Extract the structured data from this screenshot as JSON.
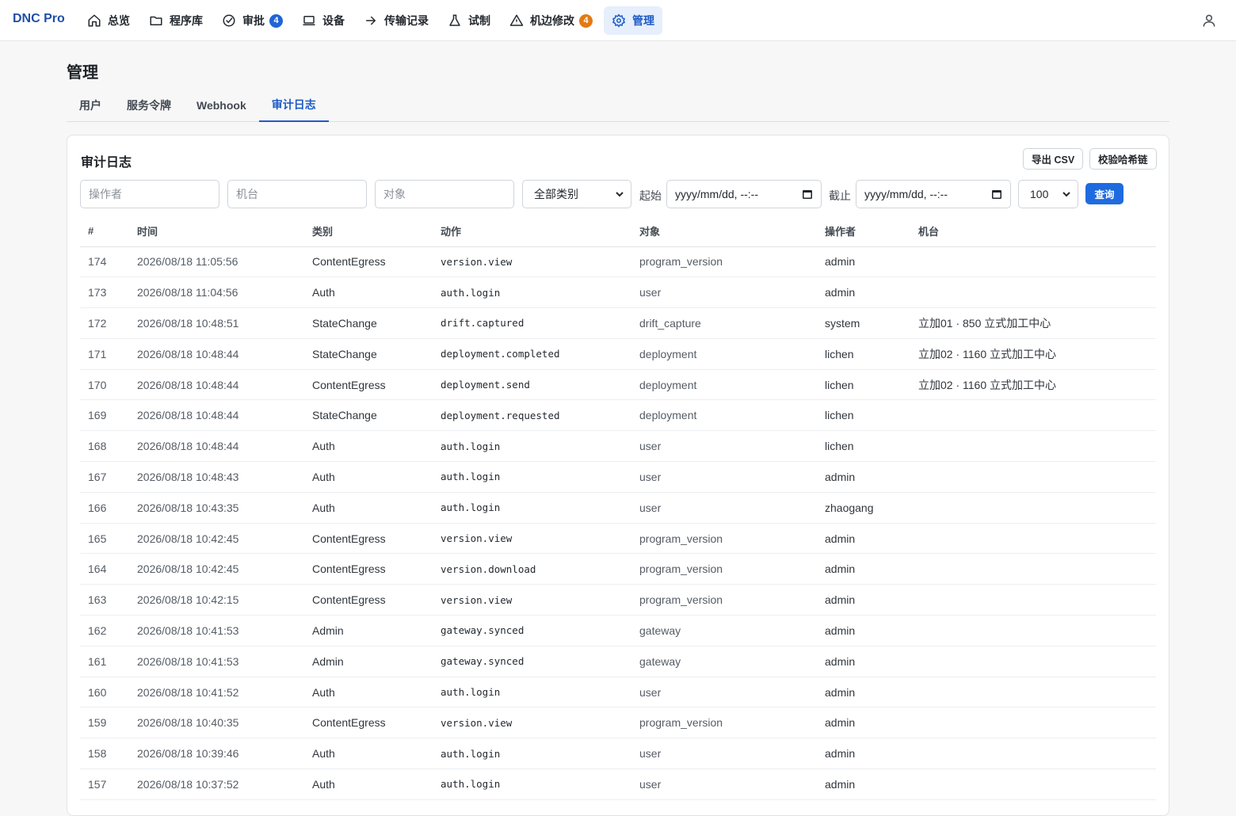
{
  "nav": {
    "brand": "DNC Pro",
    "items": [
      {
        "label": "总览",
        "icon": "home-icon",
        "badge": null
      },
      {
        "label": "程序库",
        "icon": "folder-icon",
        "badge": null
      },
      {
        "label": "审批",
        "icon": "check-circle-icon",
        "badge": "4"
      },
      {
        "label": "设备",
        "icon": "monitor-icon",
        "badge": null
      },
      {
        "label": "传输记录",
        "icon": "arrow-right-icon",
        "badge": null
      },
      {
        "label": "试制",
        "icon": "flask-icon",
        "badge": null
      },
      {
        "label": "机边修改",
        "icon": "warning-icon",
        "badge": "4"
      },
      {
        "label": "管理",
        "icon": "gear-icon",
        "badge": null
      }
    ]
  },
  "page": {
    "title": "管理",
    "tabs": [
      "用户",
      "服务令牌",
      "Webhook",
      "审计日志"
    ],
    "active_tab": "审计日志"
  },
  "card": {
    "title": "审计日志",
    "export_label": "导出 CSV",
    "verify_label": "校验哈希链"
  },
  "filters": {
    "operator_placeholder": "操作者",
    "machine_placeholder": "机台",
    "object_placeholder": "对象",
    "category_value": "全部类别",
    "start_label": "起始",
    "start_value": "yyyy/mm/dd, --:--",
    "end_label": "截止",
    "end_value": "yyyy/mm/dd, --:--",
    "limit_value": "100",
    "query_label": "查询"
  },
  "table": {
    "headers": [
      "#",
      "时间",
      "类别",
      "动作",
      "对象",
      "操作者",
      "机台"
    ],
    "rows": [
      {
        "id": "174",
        "time": "2026/08/18 11:05:56",
        "category": "ContentEgress",
        "action": "version.view",
        "object": "program_version",
        "operator": "admin",
        "machine": ""
      },
      {
        "id": "173",
        "time": "2026/08/18 11:04:56",
        "category": "Auth",
        "action": "auth.login",
        "object": "user",
        "operator": "admin",
        "machine": ""
      },
      {
        "id": "172",
        "time": "2026/08/18 10:48:51",
        "category": "StateChange",
        "action": "drift.captured",
        "object": "drift_capture",
        "operator": "system",
        "machine": "立加01 · 850 立式加工中心"
      },
      {
        "id": "171",
        "time": "2026/08/18 10:48:44",
        "category": "StateChange",
        "action": "deployment.completed",
        "object": "deployment",
        "operator": "lichen",
        "machine": "立加02 · 1160 立式加工中心"
      },
      {
        "id": "170",
        "time": "2026/08/18 10:48:44",
        "category": "ContentEgress",
        "action": "deployment.send",
        "object": "deployment",
        "operator": "lichen",
        "machine": "立加02 · 1160 立式加工中心"
      },
      {
        "id": "169",
        "time": "2026/08/18 10:48:44",
        "category": "StateChange",
        "action": "deployment.requested",
        "object": "deployment",
        "operator": "lichen",
        "machine": ""
      },
      {
        "id": "168",
        "time": "2026/08/18 10:48:44",
        "category": "Auth",
        "action": "auth.login",
        "object": "user",
        "operator": "lichen",
        "machine": ""
      },
      {
        "id": "167",
        "time": "2026/08/18 10:48:43",
        "category": "Auth",
        "action": "auth.login",
        "object": "user",
        "operator": "admin",
        "machine": ""
      },
      {
        "id": "166",
        "time": "2026/08/18 10:43:35",
        "category": "Auth",
        "action": "auth.login",
        "object": "user",
        "operator": "zhaogang",
        "machine": ""
      },
      {
        "id": "165",
        "time": "2026/08/18 10:42:45",
        "category": "ContentEgress",
        "action": "version.view",
        "object": "program_version",
        "operator": "admin",
        "machine": ""
      },
      {
        "id": "164",
        "time": "2026/08/18 10:42:45",
        "category": "ContentEgress",
        "action": "version.download",
        "object": "program_version",
        "operator": "admin",
        "machine": ""
      },
      {
        "id": "163",
        "time": "2026/08/18 10:42:15",
        "category": "ContentEgress",
        "action": "version.view",
        "object": "program_version",
        "operator": "admin",
        "machine": ""
      },
      {
        "id": "162",
        "time": "2026/08/18 10:41:53",
        "category": "Admin",
        "action": "gateway.synced",
        "object": "gateway",
        "operator": "admin",
        "machine": ""
      },
      {
        "id": "161",
        "time": "2026/08/18 10:41:53",
        "category": "Admin",
        "action": "gateway.synced",
        "object": "gateway",
        "operator": "admin",
        "machine": ""
      },
      {
        "id": "160",
        "time": "2026/08/18 10:41:52",
        "category": "Auth",
        "action": "auth.login",
        "object": "user",
        "operator": "admin",
        "machine": ""
      },
      {
        "id": "159",
        "time": "2026/08/18 10:40:35",
        "category": "ContentEgress",
        "action": "version.view",
        "object": "program_version",
        "operator": "admin",
        "machine": ""
      },
      {
        "id": "158",
        "time": "2026/08/18 10:39:46",
        "category": "Auth",
        "action": "auth.login",
        "object": "user",
        "operator": "admin",
        "machine": ""
      },
      {
        "id": "157",
        "time": "2026/08/18 10:37:52",
        "category": "Auth",
        "action": "auth.login",
        "object": "user",
        "operator": "admin",
        "machine": ""
      }
    ]
  },
  "colors": {
    "accent": "#1e5bc6",
    "primary_button": "#1e6be0",
    "badge_blue": "#2064d6",
    "badge_orange": "#e37a12"
  }
}
